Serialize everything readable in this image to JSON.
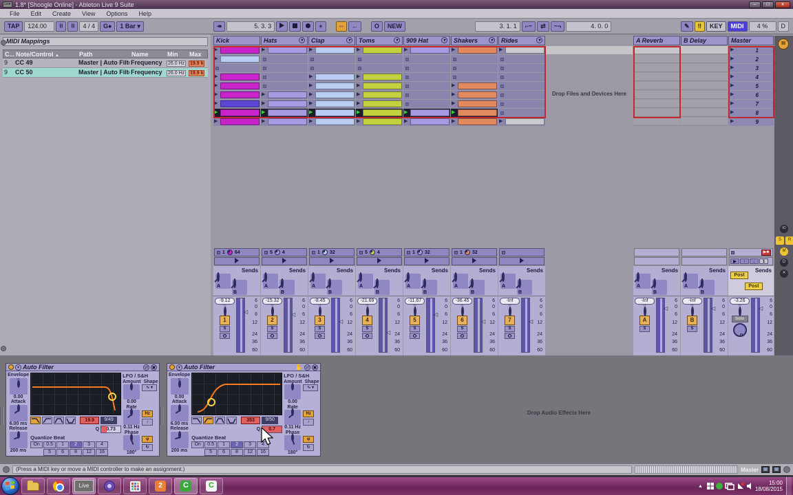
{
  "window": {
    "title": "1.8*  [Shoogle Online] - Ableton Live 9 Suite",
    "app_badge": "Live",
    "minimize": "–",
    "maximize": "□",
    "close": "x"
  },
  "menu": {
    "items": [
      "File",
      "Edit",
      "Create",
      "View",
      "Options",
      "Help"
    ]
  },
  "transport": {
    "tap": "TAP",
    "tempo": "124.00",
    "metro1": "|||",
    "metro2": "|||",
    "time_sig": "4 / 4",
    "groove": "G●",
    "groove_arrow": "▾",
    "quantize": "1 Bar ▾",
    "follow": "↠",
    "position": "5.  3.  3",
    "overdub": "+",
    "automation_arm": "◦◦",
    "back_arrow": "←",
    "session_rec": "O",
    "new_label": "NEW",
    "loop_start": "3.  1.  1",
    "punch_in": "⌐~",
    "loop": "⇄",
    "punch_out": "~¬",
    "loop_length": "4.  0.  0",
    "draw": "✎",
    "kbd": "‼",
    "key_label": "KEY",
    "midi_label": "MIDI",
    "cpu": "4 %",
    "disk": "D"
  },
  "mappings": {
    "title": "MIDI Mappings",
    "columns": {
      "ch": "C...",
      "control": "Note/Control",
      "sort": "▲",
      "path": "Path",
      "name": "Name",
      "min": "Min",
      "max": "Max"
    },
    "rows": [
      {
        "ch": "9",
        "control": "CC 49",
        "path": "Master | Auto Filter",
        "name": "Frequency",
        "min": "26.0 Hz",
        "max": "19.9 k",
        "selected": false
      },
      {
        "ch": "9",
        "control": "CC 50",
        "path": "Master | Auto Filter",
        "name": "Frequency",
        "min": "26.0 Hz",
        "max": "19.9 k",
        "selected": true
      }
    ]
  },
  "colors": {
    "magenta": "#c924c9",
    "blue": "#b9cdf2",
    "lpurple": "#a89ae0",
    "green": "#c3d13f",
    "salmon": "#e08a5e",
    "gray": "#c9c9d0",
    "violet": "#5b45d5",
    "accent_red": "#c1272d",
    "play_green": "#35d435",
    "curve_orange": "#ff7a1a"
  },
  "session": {
    "sends_label": "Sends",
    "drop_zone_label": "Drop Files and Devices Here",
    "meter_scale": [
      "6",
      "0",
      "6",
      "12",
      "24",
      "36",
      "60"
    ],
    "tracks": [
      {
        "name": "Kick",
        "menu": false,
        "clips": [
          {
            "t": "clip",
            "c": "magenta"
          },
          {
            "t": "clip",
            "c": "blue"
          },
          {
            "t": "stop"
          },
          {
            "t": "clip",
            "c": "magenta"
          },
          {
            "t": "clip",
            "c": "magenta"
          },
          {
            "t": "clip",
            "c": "magenta"
          },
          {
            "t": "clip",
            "c": "violet"
          },
          {
            "t": "clip",
            "c": "magenta",
            "playing": true
          },
          {
            "t": "clip",
            "c": "magenta"
          }
        ],
        "status": {
          "a": "1",
          "b": "64",
          "pie": "magenta"
        },
        "mixer": {
          "vol": "-9.12",
          "num": "1",
          "solo": "S",
          "fader": 22
        }
      },
      {
        "name": "Hats",
        "menu": true,
        "clips": [
          {
            "t": "clip",
            "c": "lpurple"
          },
          {
            "t": "stop"
          },
          {
            "t": "stop"
          },
          {
            "t": "stop"
          },
          {
            "t": "stop"
          },
          {
            "t": "clip",
            "c": "lpurple"
          },
          {
            "t": "clip",
            "c": "lpurple"
          },
          {
            "t": "clip",
            "c": "lpurple",
            "playing": true
          },
          {
            "t": "clip",
            "c": "lpurple"
          }
        ],
        "status": {
          "a": "5",
          "b": "4",
          "pie": "lpurple"
        },
        "mixer": {
          "vol": "-15.32",
          "num": "2",
          "solo": "S",
          "fader": 27
        }
      },
      {
        "name": "Clap",
        "menu": true,
        "clips": [
          {
            "t": "clip",
            "c": "blue"
          },
          {
            "t": "stop"
          },
          {
            "t": "stop"
          },
          {
            "t": "clip",
            "c": "blue"
          },
          {
            "t": "clip",
            "c": "blue"
          },
          {
            "t": "clip",
            "c": "blue"
          },
          {
            "t": "clip",
            "c": "blue"
          },
          {
            "t": "clip",
            "c": "blue",
            "playing": true
          },
          {
            "t": "clip",
            "c": "blue"
          }
        ],
        "status": {
          "a": "1",
          "b": "32",
          "pie": "blue"
        },
        "mixer": {
          "vol": "-8.45",
          "num": "3",
          "solo": "S",
          "fader": 40
        }
      },
      {
        "name": "Toms",
        "menu": true,
        "clips": [
          {
            "t": "clip",
            "c": "green"
          },
          {
            "t": "stop"
          },
          {
            "t": "stop"
          },
          {
            "t": "clip",
            "c": "green"
          },
          {
            "t": "clip",
            "c": "green"
          },
          {
            "t": "clip",
            "c": "green"
          },
          {
            "t": "clip",
            "c": "green"
          },
          {
            "t": "clip",
            "c": "green",
            "playing": true
          },
          {
            "t": "clip",
            "c": "green"
          }
        ],
        "status": {
          "a": "5",
          "b": "4",
          "pie": "green"
        },
        "mixer": {
          "vol": "-21.69",
          "num": "4",
          "solo": "S",
          "fader": 60
        }
      },
      {
        "name": "909 Hat",
        "menu": true,
        "clips": [
          {
            "t": "clip",
            "c": "lpurple"
          },
          {
            "t": "stop"
          },
          {
            "t": "stop"
          },
          {
            "t": "stop"
          },
          {
            "t": "stop"
          },
          {
            "t": "stop"
          },
          {
            "t": "stop"
          },
          {
            "t": "clip",
            "c": "lpurple",
            "playing": true
          },
          {
            "t": "clip",
            "c": "lpurple"
          }
        ],
        "status": {
          "a": "1",
          "b": "32",
          "pie": "lpurple"
        },
        "mixer": {
          "vol": "-11.67",
          "num": "5",
          "solo": "S",
          "fader": 27
        }
      },
      {
        "name": "Shakers",
        "menu": true,
        "clips": [
          {
            "t": "clip",
            "c": "salmon"
          },
          {
            "t": "stop"
          },
          {
            "t": "stop"
          },
          {
            "t": "stop"
          },
          {
            "t": "clip",
            "c": "salmon"
          },
          {
            "t": "clip",
            "c": "salmon"
          },
          {
            "t": "clip",
            "c": "salmon"
          },
          {
            "t": "clip",
            "c": "salmon",
            "playing": true
          },
          {
            "t": "clip",
            "c": "salmon"
          }
        ],
        "status": {
          "a": "1",
          "b": "32",
          "pie": "salmon"
        },
        "mixer": {
          "vol": "-36.45",
          "num": "6",
          "solo": "S",
          "fader": 40
        }
      },
      {
        "name": "Rides",
        "menu": true,
        "clips": [
          {
            "t": "clip",
            "c": "gray"
          },
          {
            "t": "stop"
          },
          {
            "t": "stop"
          },
          {
            "t": "stop"
          },
          {
            "t": "stop"
          },
          {
            "t": "stop"
          },
          {
            "t": "stop"
          },
          {
            "t": "stop"
          },
          {
            "t": "clip",
            "c": "gray"
          }
        ],
        "status": {
          "a": "",
          "b": "",
          "pie": ""
        },
        "mixer": {
          "vol": "-Inf",
          "num": "7",
          "solo": "S",
          "fader": 40
        }
      }
    ],
    "returns": [
      {
        "name": "A Reverb",
        "mixer": {
          "vol": "-Inf",
          "num": "A",
          "solo": "S",
          "fader": 16
        }
      },
      {
        "name": "B Delay",
        "mixer": {
          "vol": "-Inf",
          "num": "B",
          "solo": "S",
          "fader": 16
        }
      }
    ],
    "master": {
      "name": "Master",
      "scenes": [
        "1",
        "2",
        "3",
        "4",
        "5",
        "6",
        "7",
        "8",
        "9"
      ],
      "stop_all_icon": "▶■",
      "scene_play": "▶",
      "scene_up": "↑",
      "scene_down": "↓",
      "scene_box": "1",
      "post_a": "Post",
      "post_b": "Post",
      "mixer": {
        "vol": "-3.26",
        "solo_label": "Solo",
        "fader": 16
      }
    },
    "right_strip": {
      "iii": "III",
      "io": "IO",
      "s": "S",
      "r": "R",
      "m": "M",
      "d": "D",
      "x": "✕"
    }
  },
  "devices": {
    "drop_label": "Drop Audio Effects Here",
    "items": [
      {
        "title": "Auto Filter",
        "hand": false,
        "env_label": "Envelope",
        "env_amount": "0.00",
        "attack_label": "Attack",
        "attack": "6.00 ms",
        "release_label": "Release",
        "release": "200 ms",
        "curve": "lp",
        "active_filter": 0,
        "freq": "19.9",
        "map_tag": "9/49",
        "q_label": "Q",
        "q": "0.73",
        "q_mapped": false,
        "quant_label": "Quantize Beat",
        "quant_on": "On",
        "quant_row1": [
          "0.5",
          "1",
          "2",
          "3",
          "4"
        ],
        "quant_row2": [
          "5",
          "6",
          "8",
          "12",
          "16"
        ],
        "quant_active": "2",
        "lfo_label": "LFO / S&H",
        "amount_label": "Amount",
        "amount": "0.00",
        "shape_label": "Shape",
        "shape_glyph": "∿ ▾",
        "rate_label": "Rate",
        "rate": "0.11 Hz",
        "hz_label": "Hz",
        "note_glyph": "♪",
        "phase_label": "Phase",
        "phase": "180°",
        "phi": "φ",
        "spin": "↻"
      },
      {
        "title": "Auto Filter",
        "hand": true,
        "env_label": "Envelope",
        "env_amount": "0.00",
        "attack_label": "Attack",
        "attack": "6.00 ms",
        "release_label": "Release",
        "release": "200 ms",
        "curve": "hp",
        "active_filter": 1,
        "freq": "353",
        "map_tag": "9/50",
        "q_label": "Q",
        "q": "0.7",
        "q_mapped": true,
        "quant_label": "Quantize Beat",
        "quant_on": "On",
        "quant_row1": [
          "0.5",
          "1",
          "2",
          "3",
          "4"
        ],
        "quant_row2": [
          "5",
          "6",
          "8",
          "12",
          "16"
        ],
        "quant_active": "2",
        "lfo_label": "LFO / S&H",
        "amount_label": "Amount",
        "amount": "0.00",
        "shape_label": "Shape",
        "shape_glyph": "∿ ▾",
        "rate_label": "Rate",
        "rate": "0.11 Hz",
        "hz_label": "Hz",
        "note_glyph": "♪",
        "phase_label": "Phase",
        "phase": "180°",
        "phi": "φ",
        "spin": "↻"
      }
    ]
  },
  "status_bar": {
    "info": "(Press a MIDI key or move a MIDI controller to make an assignment.)",
    "master_label": "Master"
  },
  "taskbar": {
    "live_label": "Live",
    "badge_count": "2",
    "cam1": "C",
    "cam2": "C",
    "tray_expand": "▲",
    "time": "15:00",
    "date": "18/08/2015"
  }
}
